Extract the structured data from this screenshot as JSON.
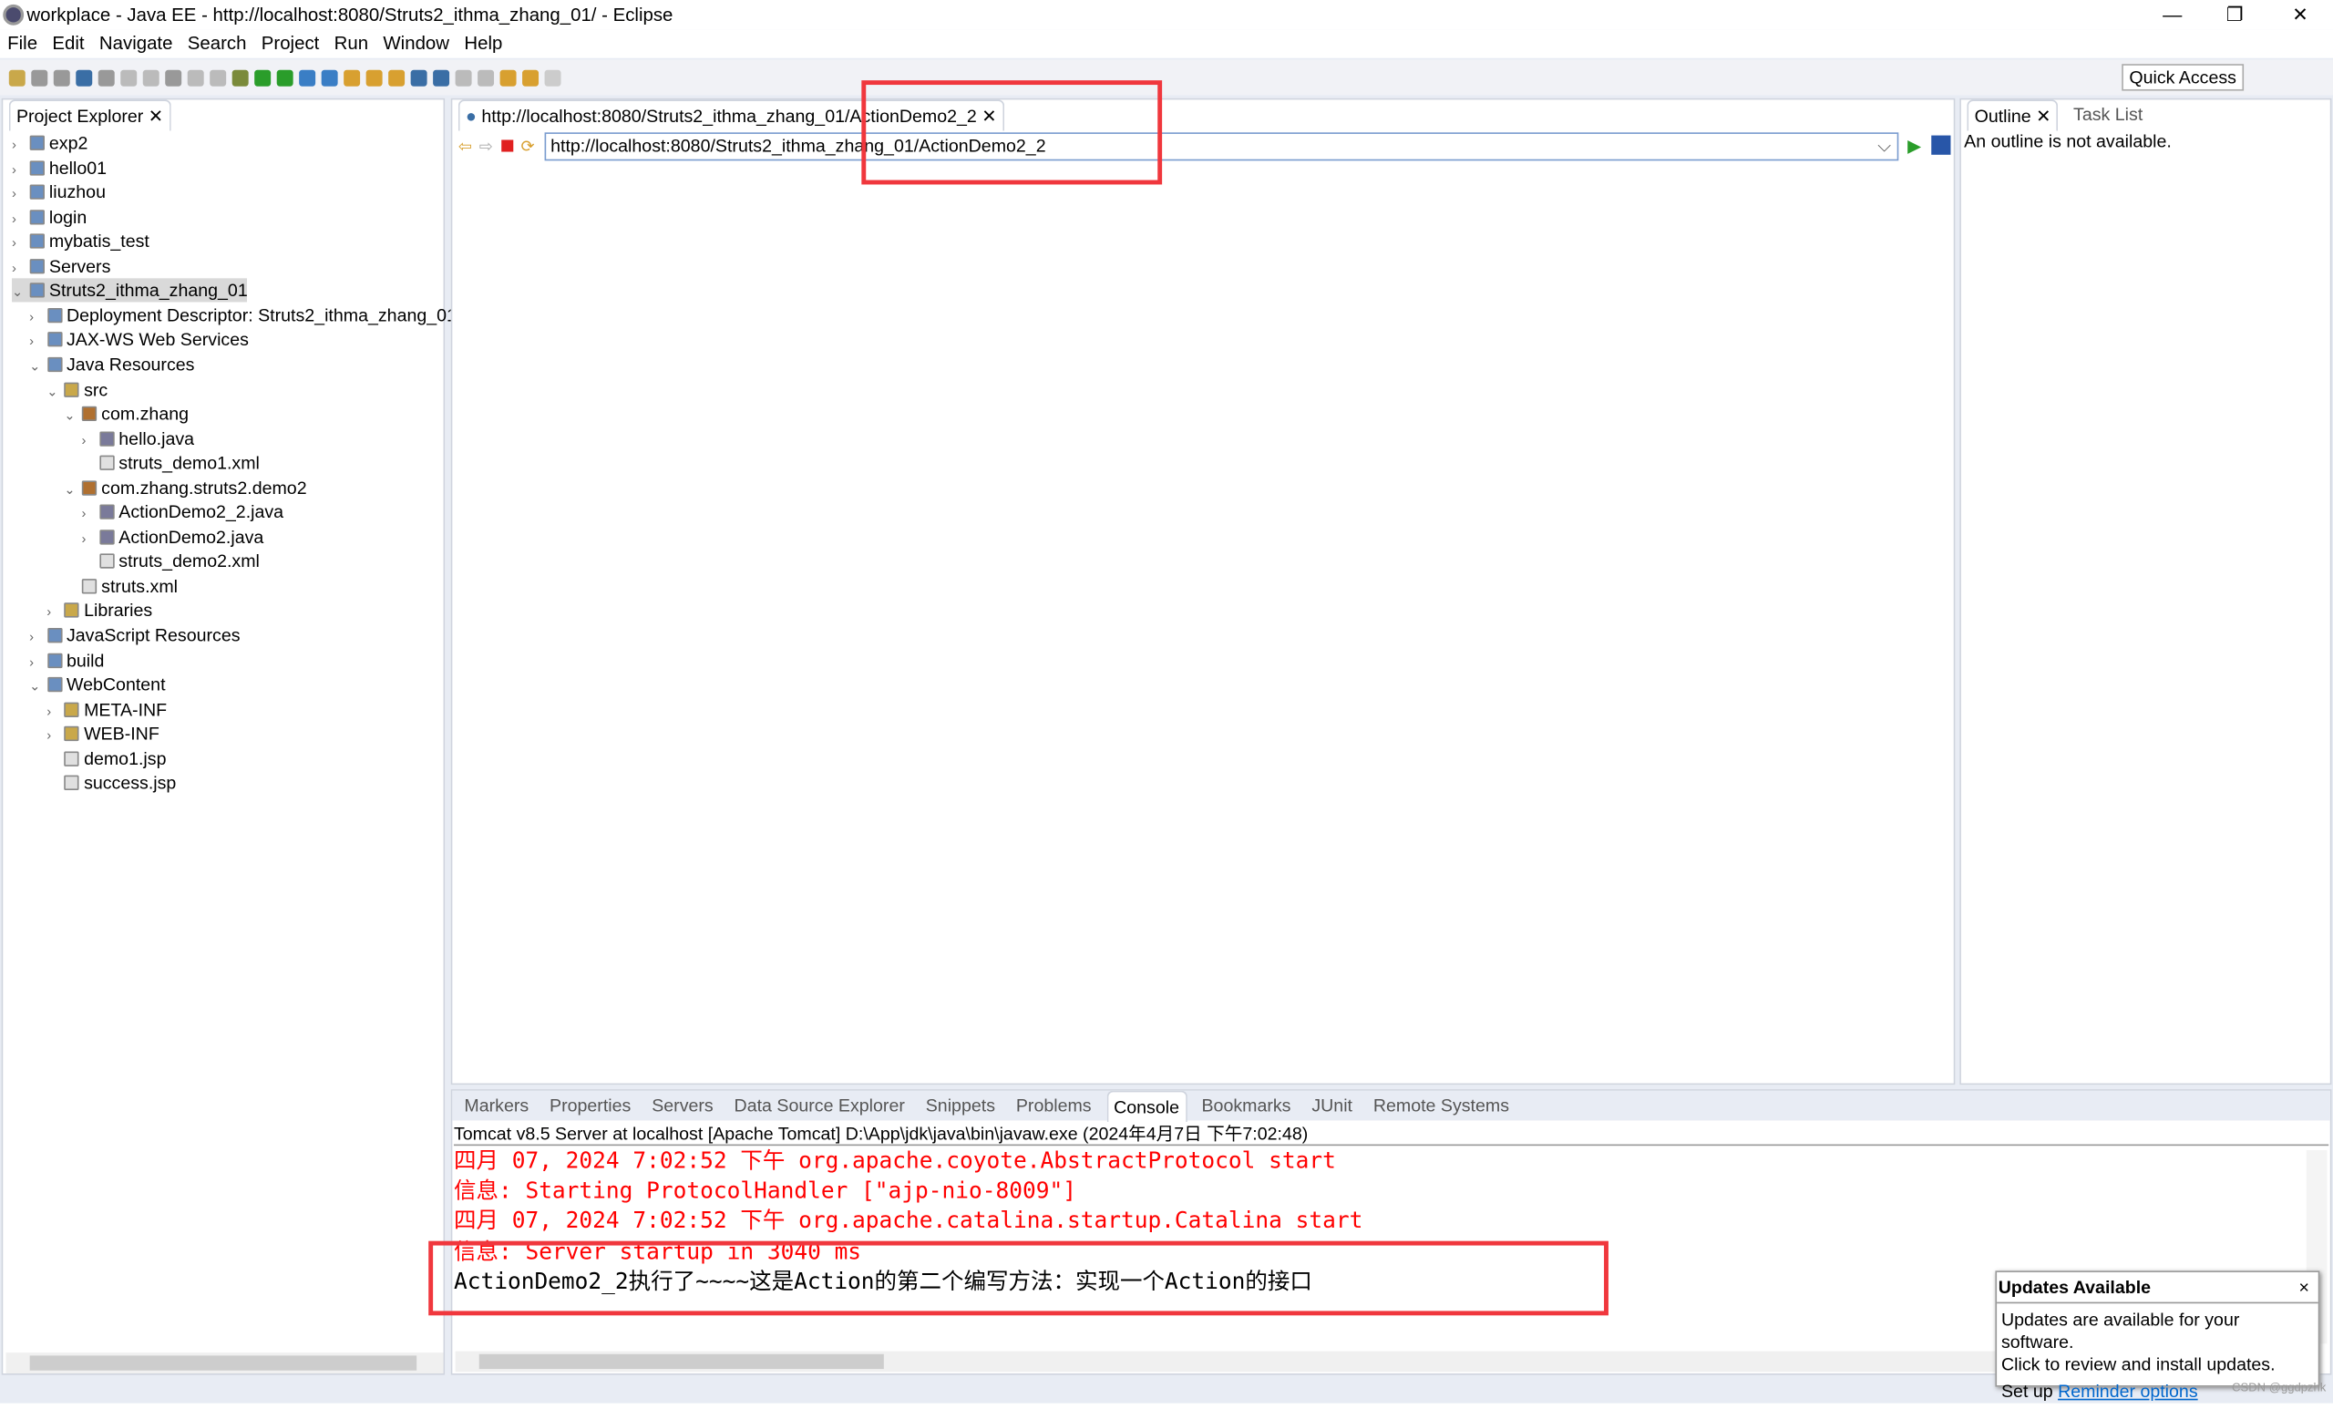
{
  "window": {
    "title": "workplace - Java EE - http://localhost:8080/Struts2_ithma_zhang_01/ - Eclipse",
    "minimize": "—",
    "restore": "❐",
    "close": "✕"
  },
  "menu": [
    "File",
    "Edit",
    "Navigate",
    "Search",
    "Project",
    "Run",
    "Window",
    "Help"
  ],
  "quick_access": "Quick Access",
  "project_explorer": {
    "title": "Project Explorer",
    "items": [
      {
        "label": "exp2",
        "level": 0,
        "expanded": false
      },
      {
        "label": "hello01",
        "level": 0,
        "expanded": false
      },
      {
        "label": "liuzhou",
        "level": 0,
        "expanded": false
      },
      {
        "label": "login",
        "level": 0,
        "expanded": false
      },
      {
        "label": "mybatis_test",
        "level": 0,
        "expanded": false
      },
      {
        "label": "Servers",
        "level": 0,
        "expanded": false
      },
      {
        "label": "Struts2_ithma_zhang_01",
        "level": 0,
        "expanded": true,
        "selected": true
      },
      {
        "label": "Deployment Descriptor: Struts2_ithma_zhang_01",
        "level": 1,
        "expanded": false
      },
      {
        "label": "JAX-WS Web Services",
        "level": 1,
        "expanded": false
      },
      {
        "label": "Java Resources",
        "level": 1,
        "expanded": true
      },
      {
        "label": "src",
        "level": 2,
        "expanded": true
      },
      {
        "label": "com.zhang",
        "level": 3,
        "expanded": true
      },
      {
        "label": "hello.java",
        "level": 4,
        "expanded": false
      },
      {
        "label": "struts_demo1.xml",
        "level": 4,
        "leaf": true
      },
      {
        "label": "com.zhang.struts2.demo2",
        "level": 3,
        "expanded": true
      },
      {
        "label": "ActionDemo2_2.java",
        "level": 4,
        "expanded": false
      },
      {
        "label": "ActionDemo2.java",
        "level": 4,
        "expanded": false
      },
      {
        "label": "struts_demo2.xml",
        "level": 4,
        "leaf": true
      },
      {
        "label": "struts.xml",
        "level": 3,
        "leaf": true
      },
      {
        "label": "Libraries",
        "level": 2,
        "expanded": false
      },
      {
        "label": "JavaScript Resources",
        "level": 1,
        "expanded": false
      },
      {
        "label": "build",
        "level": 1,
        "expanded": false
      },
      {
        "label": "WebContent",
        "level": 1,
        "expanded": true
      },
      {
        "label": "META-INF",
        "level": 2,
        "expanded": false
      },
      {
        "label": "WEB-INF",
        "level": 2,
        "expanded": false
      },
      {
        "label": "demo1.jsp",
        "level": 2,
        "leaf": true
      },
      {
        "label": "success.jsp",
        "level": 2,
        "leaf": true
      }
    ]
  },
  "browser": {
    "tab_title": "http://localhost:8080/Struts2_ithma_zhang_01/ActionDemo2_2",
    "url": "http://localhost:8080/Struts2_ithma_zhang_01/ActionDemo2_2"
  },
  "outline": {
    "tabs": [
      "Outline",
      "Task List"
    ],
    "message": "An outline is not available."
  },
  "bottom": {
    "tabs": [
      "Markers",
      "Properties",
      "Servers",
      "Data Source Explorer",
      "Snippets",
      "Problems",
      "Console",
      "Bookmarks",
      "JUnit",
      "Remote Systems"
    ],
    "active": "Console",
    "console_header": "Tomcat v8.5 Server at localhost [Apache Tomcat] D:\\App\\jdk\\java\\bin\\javaw.exe (2024年4月7日 下午7:02:48)",
    "lines": [
      {
        "text": "四月 07, 2024 7:02:52 下午 org.apache.coyote.AbstractProtocol start",
        "color": "#ff0000"
      },
      {
        "text": "信息: Starting ProtocolHandler [\"ajp-nio-8009\"]",
        "color": "#ff0000"
      },
      {
        "text": "四月 07, 2024 7:02:52 下午 org.apache.catalina.startup.Catalina start",
        "color": "#ff0000"
      },
      {
        "text": "信息: Server startup in 3040 ms",
        "color": "#ff0000"
      },
      {
        "text": "ActionDemo2_2执行了~~~~这是Action的第二个编写方法：实现一个Action的接口",
        "color": "#000000"
      }
    ]
  },
  "updates": {
    "title": "Updates Available",
    "close": "×",
    "line1": "Updates are available for your software.",
    "line2": "Click to review and install updates.",
    "setup": "Set up ",
    "link": "Reminder options"
  },
  "watermark": "CSDN @ggdpzhk",
  "colors": {
    "highlight_box": "#f0373d",
    "console_error": "#ff0000",
    "link": "#0066cc"
  }
}
